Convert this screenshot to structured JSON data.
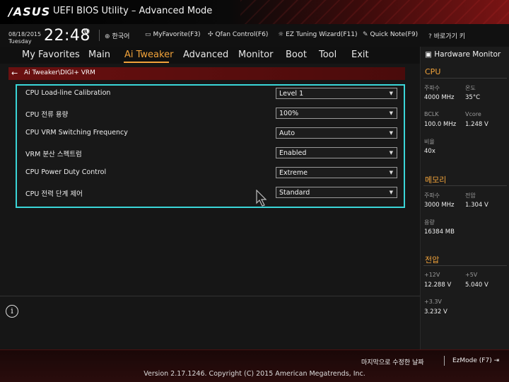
{
  "window": {
    "logo": "/ASUS",
    "title": "UEFI BIOS Utility – Advanced Mode"
  },
  "infobar": {
    "date": "08/18/2015",
    "weekday": "Tuesday",
    "time": "22:48",
    "items": [
      {
        "icon": "globe-icon",
        "label": "한국어"
      },
      {
        "icon": "favorite-icon",
        "label": "MyFavorite(F3)"
      },
      {
        "icon": "fan-icon",
        "label": "Qfan Control(F6)"
      },
      {
        "icon": "bulb-icon",
        "label": "EZ Tuning Wizard(F11)"
      },
      {
        "icon": "note-icon",
        "label": "Quick Note(F9)"
      },
      {
        "icon": "help-icon",
        "label": "바로가기 키"
      }
    ]
  },
  "menu": {
    "items": [
      "My Favorites",
      "Main",
      "Ai Tweaker",
      "Advanced",
      "Monitor",
      "Boot",
      "Tool",
      "Exit"
    ],
    "active": "Ai Tweaker"
  },
  "breadcrumb": "Ai Tweaker\\DIGI+ VRM",
  "settings": [
    {
      "label": "CPU Load-line Calibration",
      "value": "Level 1"
    },
    {
      "label": "CPU 전류 용량",
      "value": "100%"
    },
    {
      "label": "CPU VRM Switching Frequency",
      "value": "Auto"
    },
    {
      "label": "VRM 분산 스펙트럼",
      "value": "Enabled"
    },
    {
      "label": "CPU Power Duty Control",
      "value": "Extreme"
    },
    {
      "label": "CPU 전력 단계 제어",
      "value": "Standard"
    }
  ],
  "hardware_monitor": {
    "title": "Hardware Monitor",
    "cpu": {
      "heading": "CPU",
      "freq_label": "주파수",
      "freq": "4000 MHz",
      "temp_label": "온도",
      "temp": "35°C",
      "bclk_label": "BCLK",
      "bclk": "100.0 MHz",
      "vcore_label": "Vcore",
      "vcore": "1.248 V",
      "ratio_label": "비율",
      "ratio": "40x"
    },
    "memory": {
      "heading": "메모리",
      "freq_label": "주파수",
      "freq": "3000 MHz",
      "volt_label": "전압",
      "volt": "1.304 V",
      "cap_label": "용량",
      "cap": "16384 MB"
    },
    "voltage": {
      "heading": "전압",
      "v12_label": "+12V",
      "v12": "12.288 V",
      "v5_label": "+5V",
      "v5": "5.040 V",
      "v33_label": "+3.3V",
      "v33": "3.232 V"
    }
  },
  "footer": {
    "last_modified": "마지막으로 수정한 날짜",
    "ezmode": "EzMode (F7)",
    "version": "Version 2.17.1246. Copyright (C) 2015 American Megatrends, Inc."
  },
  "colors": {
    "accent": "#f2a33a",
    "highlight_border": "#3ad6d8",
    "brand_red": "#7a1414"
  }
}
